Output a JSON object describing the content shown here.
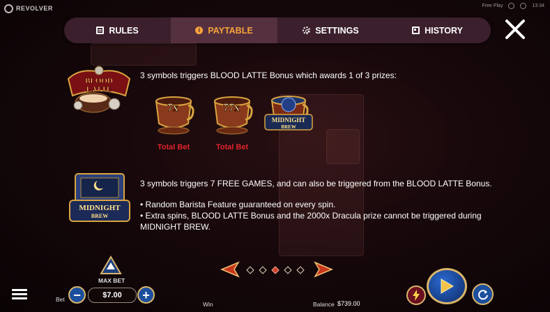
{
  "brand": {
    "name": "REVOLVER"
  },
  "top_right": {
    "free_play": "Free Play",
    "clock": "13:34"
  },
  "menu": {
    "tabs": [
      {
        "label": "RULES",
        "icon": "book-icon",
        "active": false
      },
      {
        "label": "PAYTABLE",
        "icon": "info-icon",
        "active": true
      },
      {
        "label": "SETTINGS",
        "icon": "gear-icon",
        "active": false
      },
      {
        "label": "HISTORY",
        "icon": "history-icon",
        "active": false
      }
    ]
  },
  "paytable": {
    "blood_latte": {
      "symbol_text_top": "BLOOD",
      "symbol_text_bottom": "LATTE",
      "description": "3 symbols triggers BLOOD LATTE Bonus which awards 1 of 3 prizes:",
      "prizes": [
        {
          "cup_text": "7x",
          "label": "Total Bet"
        },
        {
          "cup_text": "77x",
          "label": "Total Bet"
        },
        {
          "cup_text_top": "MIDNIGHT",
          "cup_text_bottom": "BREW",
          "label": ""
        }
      ]
    },
    "midnight_brew": {
      "symbol_text_top": "MIDNIGHT",
      "symbol_text_bottom": "BREW",
      "description": "3 symbols triggers 7 FREE GAMES, and can also be triggered from the BLOOD LATTE Bonus.",
      "bullet1": "• Random Barista Feature guaranteed on every spin.",
      "bullet2_line1": "• Extra spins, BLOOD LATTE Bonus and the 2000x Dracula prize cannot be triggered during",
      "bullet2_line2": "MIDNIGHT BREW."
    },
    "pagination": {
      "pages": 5,
      "current": 3
    }
  },
  "bottom": {
    "max_bet_label": "MAX BET",
    "bet_label": "Bet",
    "bet_value": "$7.00",
    "win_label": "Win",
    "balance_label": "Balance",
    "balance_value": "$739.00"
  },
  "colors": {
    "accent": "#f6a33b",
    "menu_bg": "#3b1f2c",
    "menu_active": "#55303f",
    "prize_red": "#e0232b",
    "button_blue": "#1c4f9e"
  }
}
